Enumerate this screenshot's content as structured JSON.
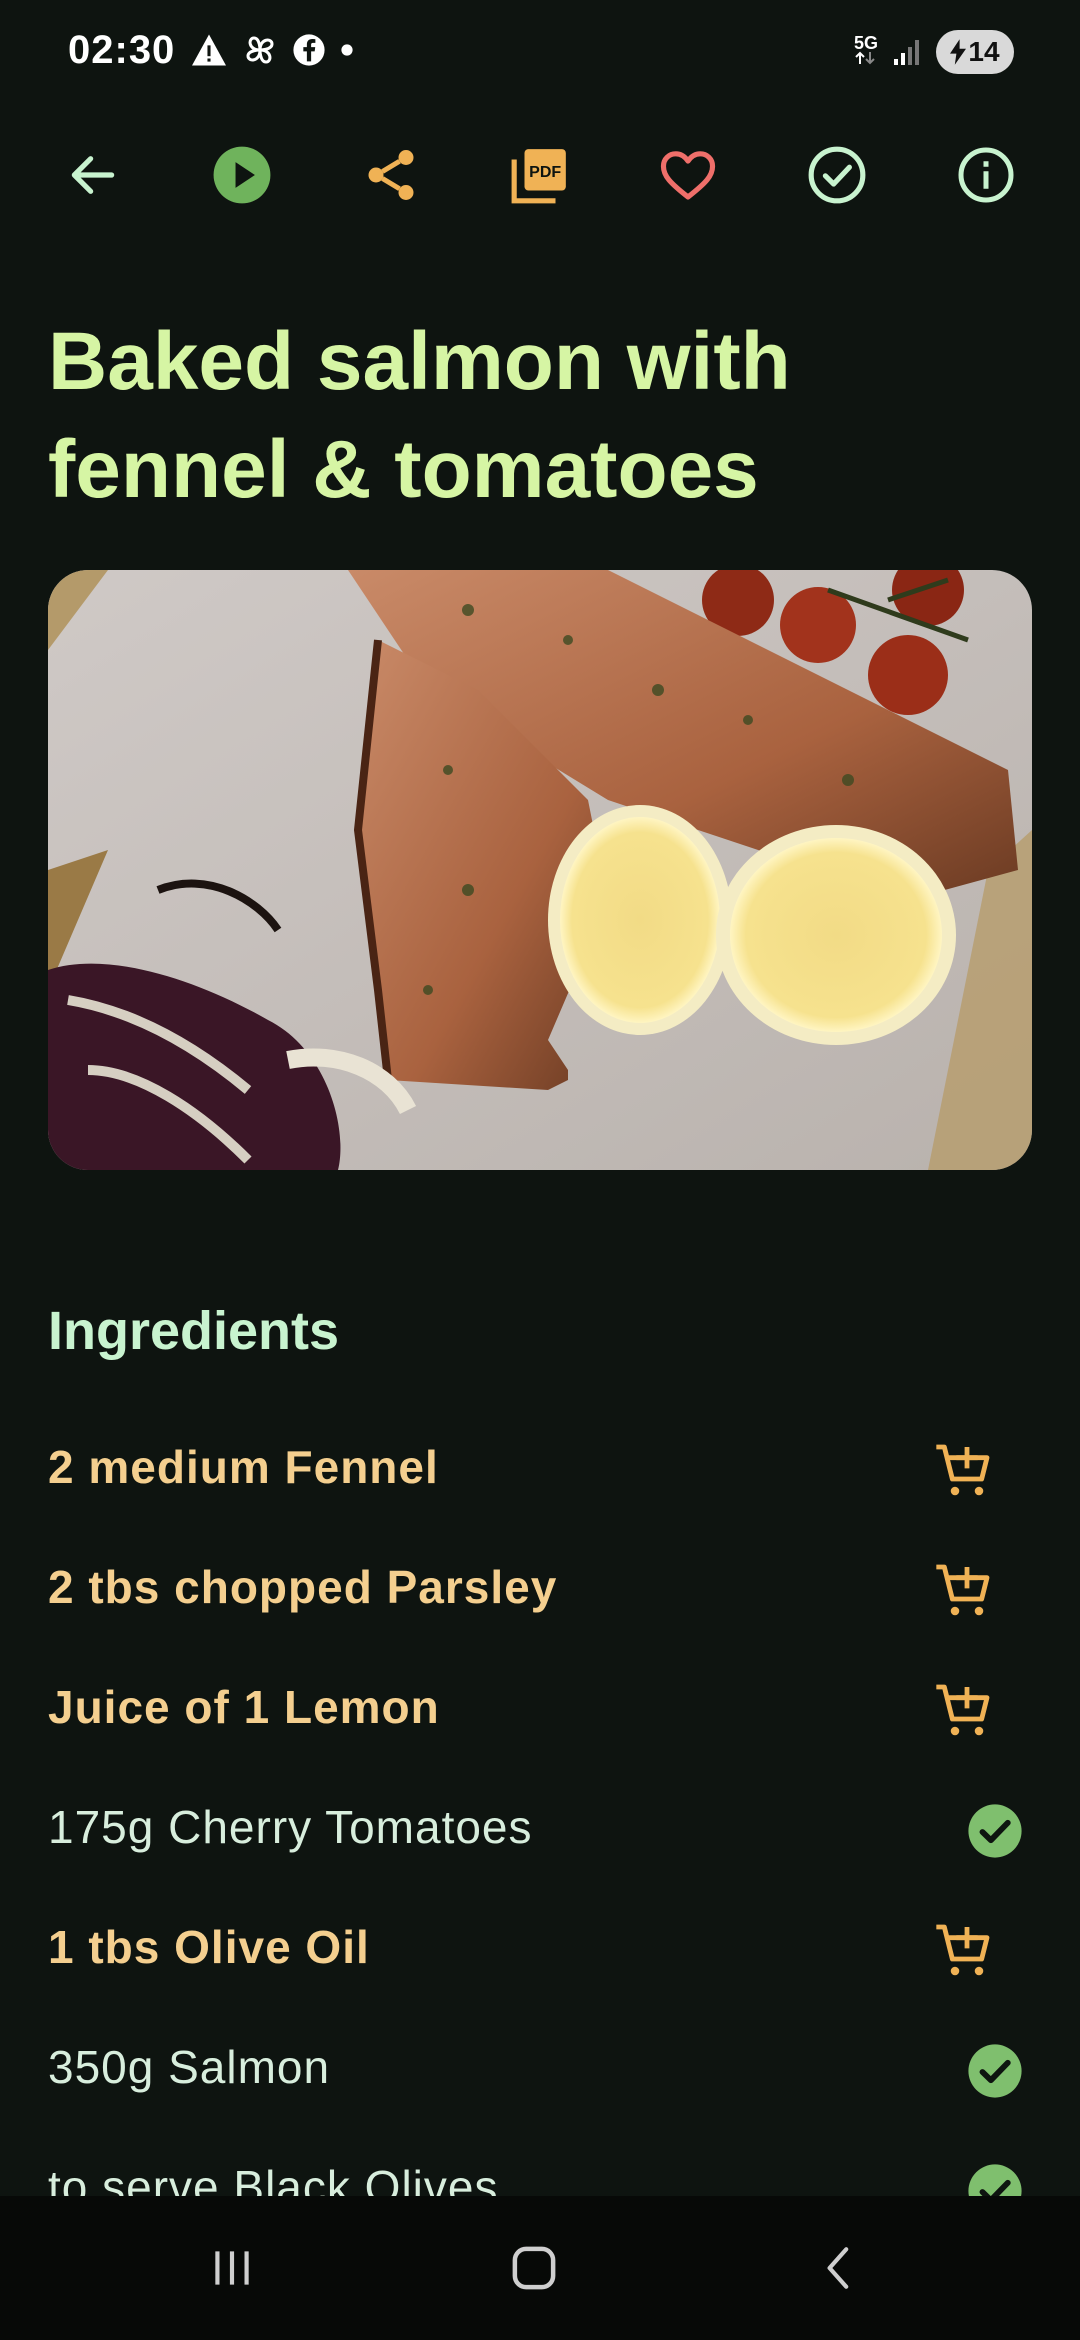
{
  "status_bar": {
    "time": "02:30",
    "network": "5G",
    "battery": "14"
  },
  "toolbar": {
    "back_icon": "arrow-left-icon",
    "play_icon": "play-circle-icon",
    "share_icon": "share-icon",
    "pdf_icon": "pdf-icon",
    "pdf_label": "PDF",
    "favorite_icon": "heart-outline-icon",
    "done_icon": "check-circle-outline-icon",
    "info_icon": "info-icon"
  },
  "recipe": {
    "title": "Baked salmon with fennel & tomatoes"
  },
  "ingredients": {
    "heading": "Ingredients",
    "items": [
      {
        "text": "2 medium Fennel",
        "status": "add-to-cart"
      },
      {
        "text": "2 tbs chopped Parsley",
        "status": "add-to-cart"
      },
      {
        "text": "Juice of 1 Lemon",
        "status": "add-to-cart"
      },
      {
        "text": "175g Cherry Tomatoes",
        "status": "in-stock"
      },
      {
        "text": "1 tbs Olive Oil",
        "status": "add-to-cart"
      },
      {
        "text": "350g Salmon",
        "status": "in-stock"
      },
      {
        "text": "to serve Black Olives",
        "status": "in-stock"
      }
    ]
  },
  "colors": {
    "background": "#0e1410",
    "title": "#d6f5a4",
    "heading": "#c8f3cf",
    "needed_item": "#f4cf8f",
    "owned_item": "#d8eedd",
    "accent_green": "#7fbf6e",
    "accent_orange": "#f0b255",
    "favorite_red": "#ef6f6a"
  }
}
